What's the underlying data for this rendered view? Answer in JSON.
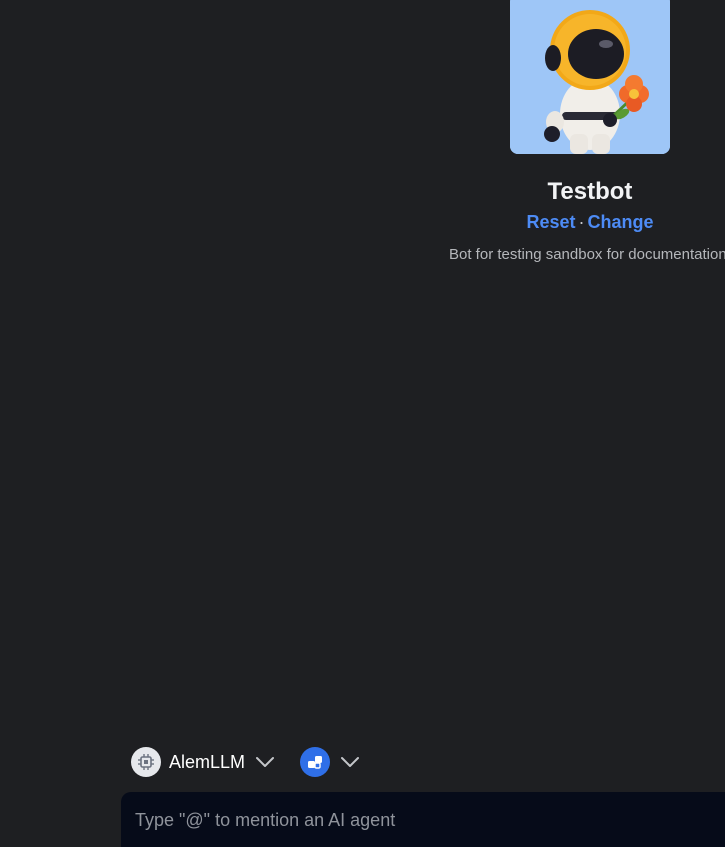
{
  "bot": {
    "name": "Testbot",
    "reset_label": "Reset",
    "separator": "·",
    "change_label": "Change",
    "description": "Bot for testing sandbox for documentation"
  },
  "composer": {
    "model_label": "AlemLLM",
    "model_icon": "cpu-chip-icon",
    "agent_icon": "agent-blocks-icon",
    "input_placeholder": "Type \"@\" to mention an AI agent"
  },
  "colors": {
    "background": "#1e1f22",
    "link": "#4d8bf5",
    "input_background": "#060b19",
    "agent_accent": "#2f6fe8",
    "avatar_background": "#9ec6f7"
  }
}
